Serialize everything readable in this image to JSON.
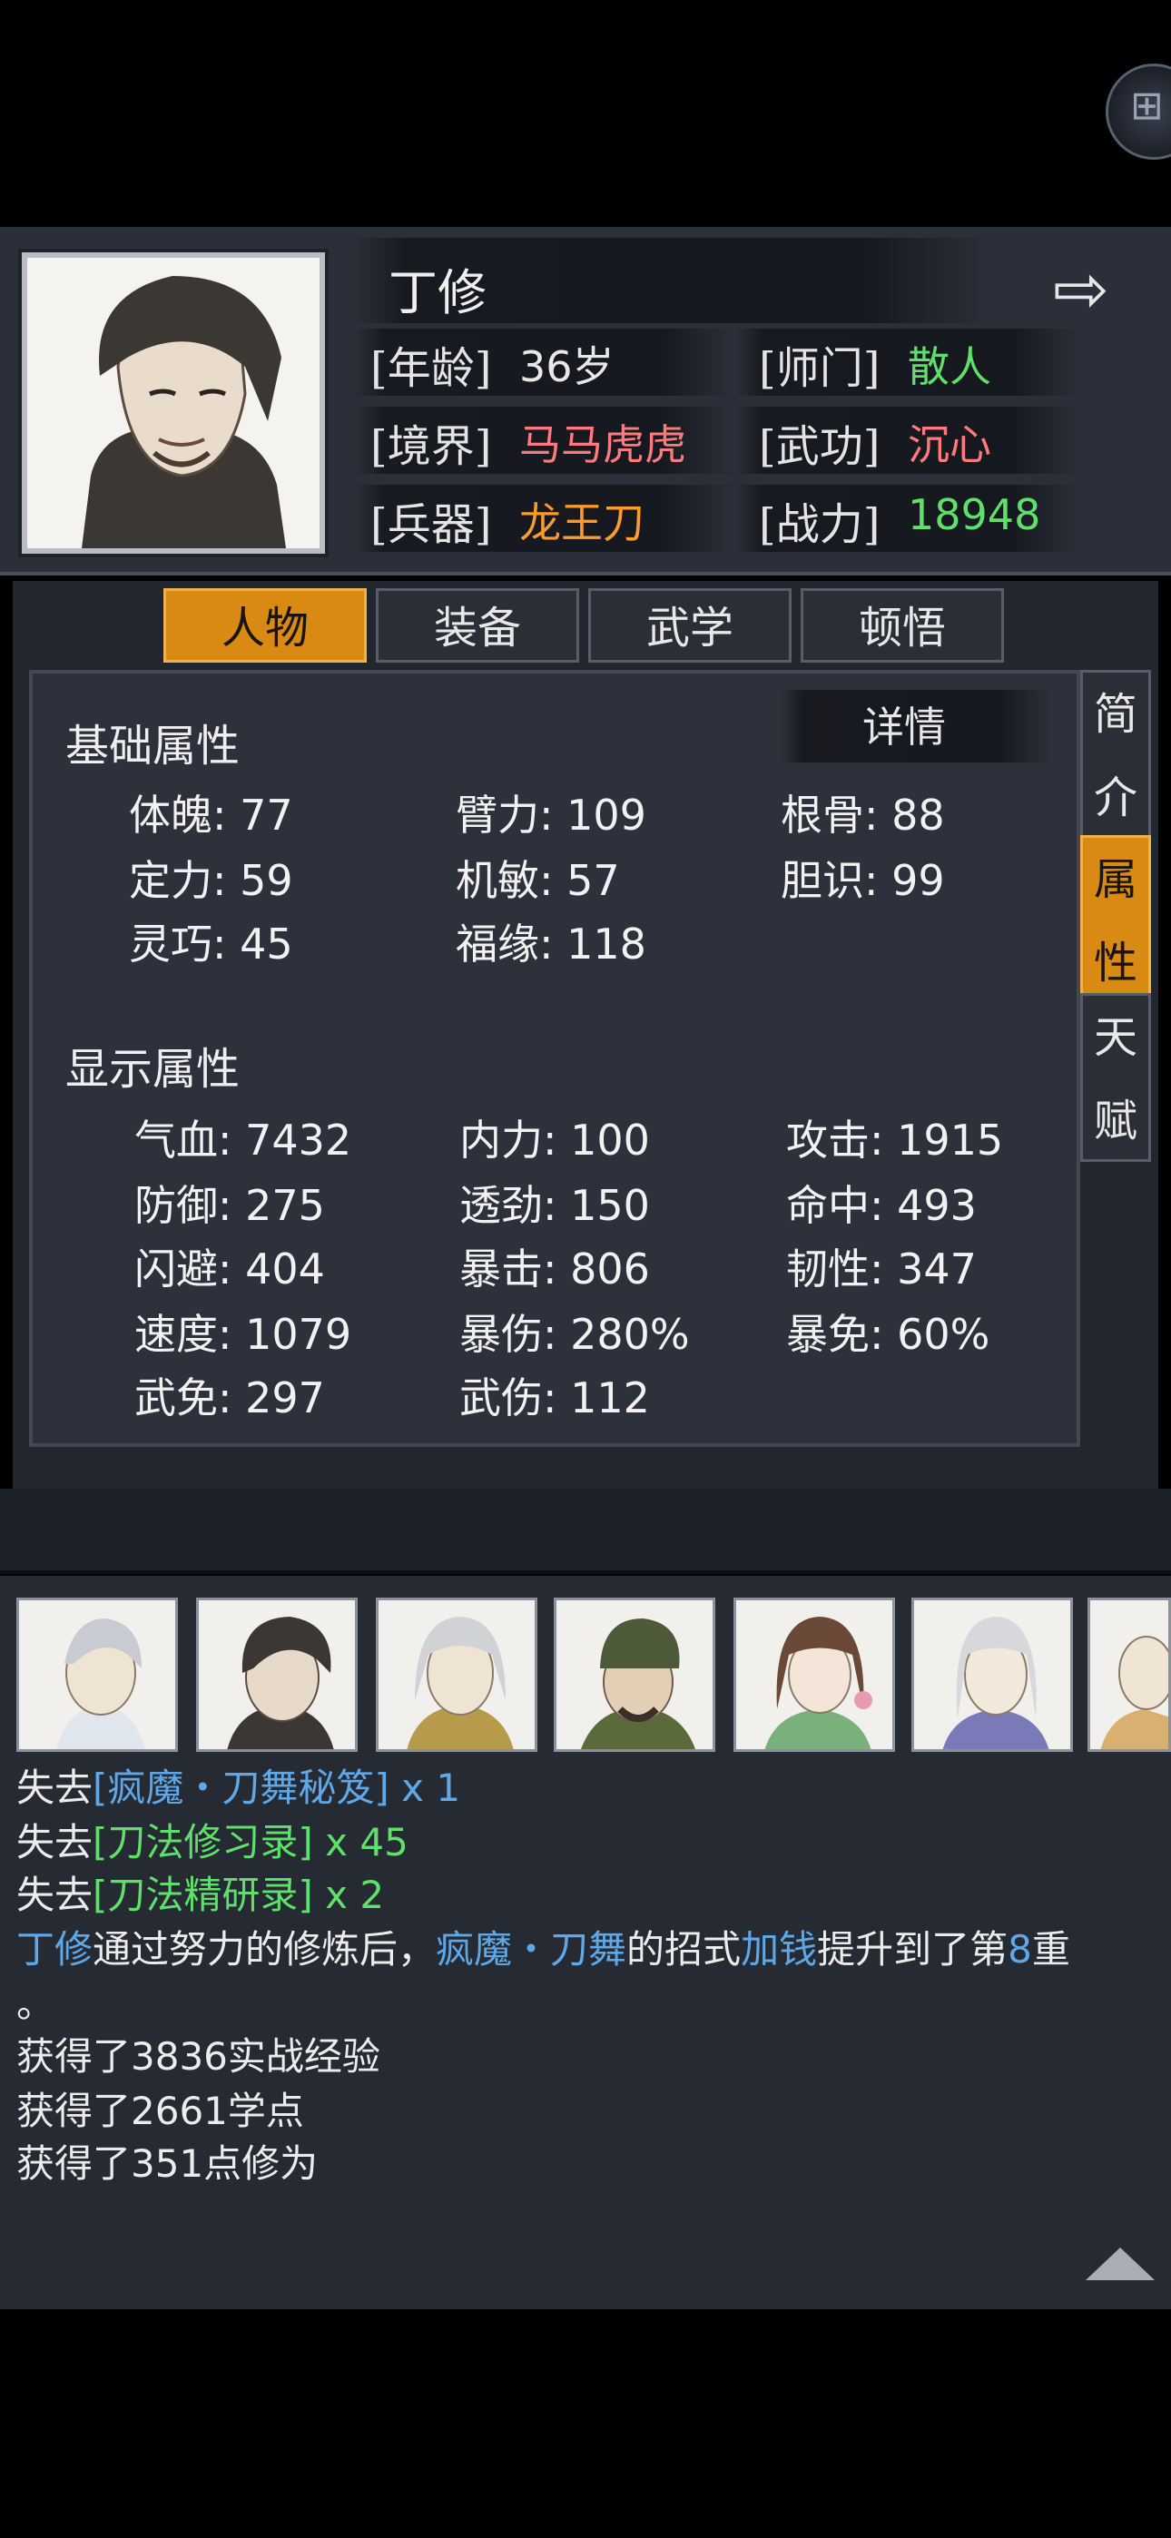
{
  "header": {
    "name": "丁修",
    "next_icon": "arrow-right-icon",
    "info": [
      {
        "label": "[年龄]",
        "value": "36岁",
        "color": "#e8e8e8"
      },
      {
        "label": "[师门]",
        "value": "散人",
        "color": "#5fe06a"
      },
      {
        "label": "[境界]",
        "value": "马马虎虎",
        "color": "#ff7a7a"
      },
      {
        "label": "[武功]",
        "value": "沉心",
        "color": "#ff7a7a"
      },
      {
        "label": "[兵器]",
        "value": "龙王刀",
        "color": "#ff9a2e"
      },
      {
        "label": "[战力]",
        "value": "18948",
        "color": "#5fe06a"
      }
    ]
  },
  "tabs": [
    "人物",
    "装备",
    "武学",
    "顿悟"
  ],
  "active_tab": "人物",
  "side_tabs": [
    {
      "chars": [
        "简",
        "介"
      ]
    },
    {
      "chars": [
        "属",
        "性"
      ]
    },
    {
      "chars": [
        "天",
        "赋"
      ]
    }
  ],
  "active_side_tab": "属性",
  "detail_label": "详情",
  "basic": {
    "title": "基础属性",
    "stats": [
      "体魄: 77",
      "臂力: 109",
      "根骨: 88",
      "定力: 59",
      "机敏: 57",
      "胆识: 99",
      "灵巧: 45",
      "福缘: 118"
    ]
  },
  "display": {
    "title": "显示属性",
    "stats": [
      "气血: 7432",
      "内力: 100",
      "攻击: 1915",
      "防御: 275",
      "透劲: 150",
      "命中: 493",
      "闪避: 404",
      "暴击: 806",
      "韧性: 347",
      "速度: 1079",
      "暴伤: 280%",
      "暴免: 60%",
      "武免: 297",
      "武伤: 112"
    ]
  },
  "log": {
    "line1": {
      "a": "失去",
      "b": "[疯魔・刀舞秘笈]",
      "c": " x 1"
    },
    "line2": {
      "a": "失去",
      "b": "[刀法修习录]",
      "c": " x 45"
    },
    "line3": {
      "a": "失去",
      "b": "[刀法精研录]",
      "c": " x 2"
    },
    "line4": {
      "a": "丁修",
      "b": "通过努力的修炼后，",
      "c": "疯魔・刀舞",
      "d": "的招式",
      "e": "加钱",
      "f": "提升到了第",
      "g": "8",
      "h": "重"
    },
    "line4b": "。",
    "line5": "获得了3836实战经验",
    "line6": "获得了2661学点",
    "line7": "获得了351点修为"
  },
  "colors": {
    "accent": "#d98a12",
    "log_blue": "#5fa8e8",
    "log_green": "#5fe06a"
  }
}
